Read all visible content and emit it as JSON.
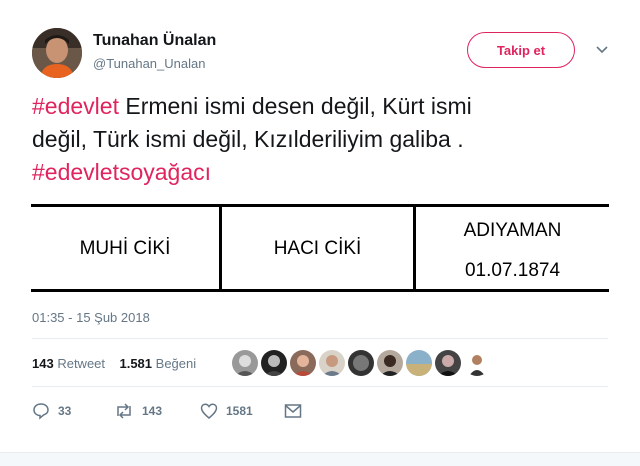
{
  "author": {
    "name": "Tunahan Ünalan",
    "handle": "@Tunahan_Unalan"
  },
  "follow_button": {
    "label": "Takip et"
  },
  "tweet": {
    "hashtag1": "#edevlet",
    "line1_text": " Ermeni ismi desen değil, Kürt ismi",
    "line2_text": "değil, Türk ismi değil, Kızılderiliyim galiba .",
    "hashtag2": "#edevletsoyağacı"
  },
  "media": {
    "cells": [
      "MUHİ CİKİ",
      "HACI CİKİ"
    ],
    "place": "ADIYAMAN",
    "date": "01.07.1874"
  },
  "timestamp": "01:35 - 15 Şub 2018",
  "stats": {
    "retweets_count": "143",
    "retweets_label": "Retweet",
    "likes_count": "1.581",
    "likes_label": "Beğeni"
  },
  "actions": {
    "reply_count": "33",
    "retweet_count": "143",
    "like_count": "1581"
  },
  "colors": {
    "accent": "#e0245e",
    "secondary_text": "#657786",
    "divider": "#e6ecf0"
  },
  "icons": [
    "chevron-down-icon",
    "reply-icon",
    "retweet-icon",
    "heart-icon",
    "envelope-icon"
  ]
}
